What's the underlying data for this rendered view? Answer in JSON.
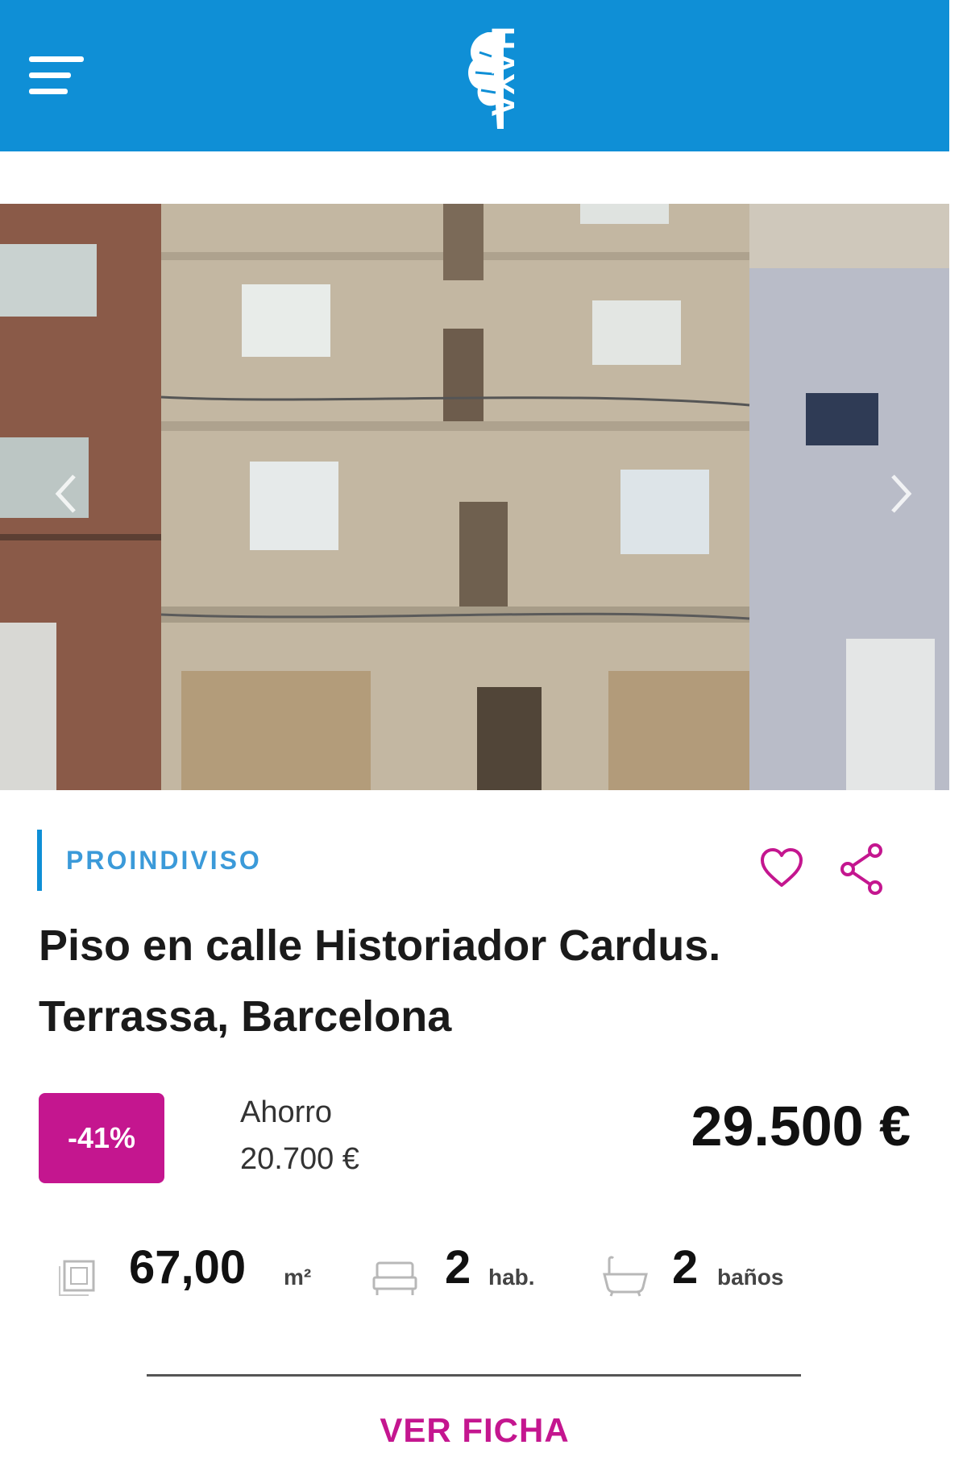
{
  "header": {
    "menu_icon": "hamburger-menu-icon",
    "logo_text": "HAYA",
    "bg_color": "#0f8fd6"
  },
  "listing": {
    "tag": "PROINDIVISO",
    "title_line1": "Piso en calle Historiador Cardus.",
    "title_line2": "Terrassa, Barcelona",
    "discount": "-41%",
    "savings_label": "Ahorro",
    "savings_value": "20.700 €",
    "price": "29.500 €",
    "favorite_icon": "heart-icon",
    "share_icon": "share-icon"
  },
  "features": {
    "area_value": "67,00",
    "area_unit": "m²",
    "rooms_value": "2",
    "rooms_unit": "hab.",
    "baths_value": "2",
    "baths_unit": "baños"
  },
  "cta_label": "VER FICHA",
  "colors": {
    "accent_pink": "#c4168f",
    "brand_blue": "#0f8fd6"
  }
}
